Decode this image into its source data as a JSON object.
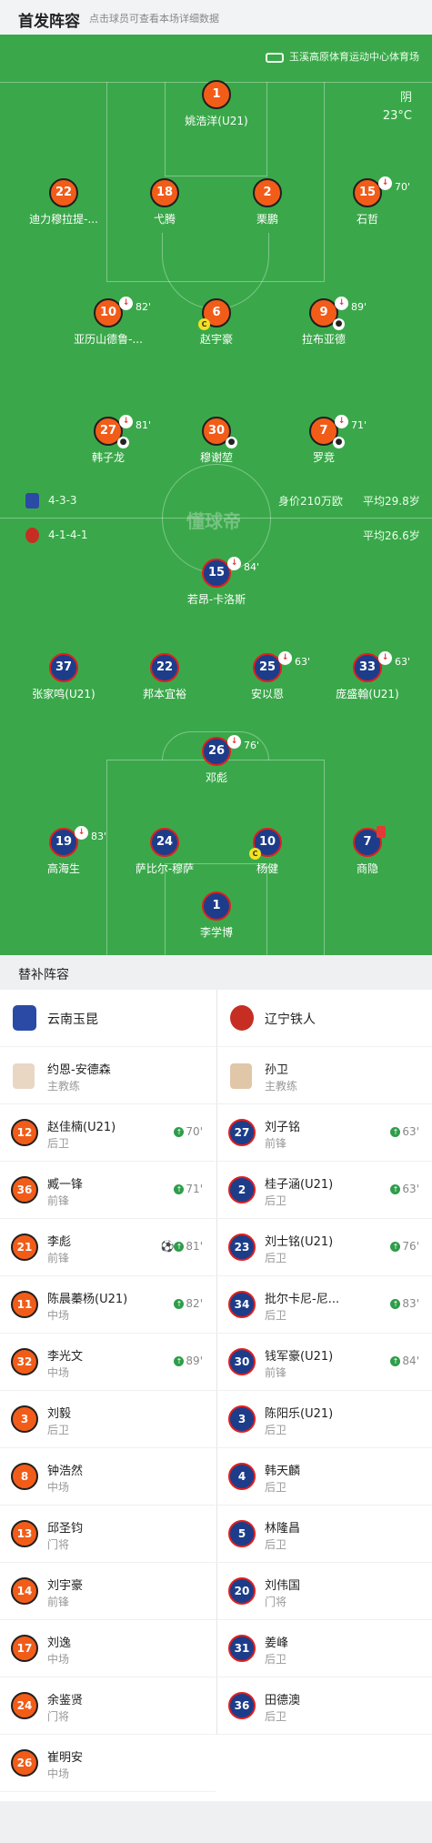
{
  "header": {
    "title": "首发阵容",
    "subtitle": "点击球员可查看本场详细数据"
  },
  "venue": "玉溪高原体育运动中心体育场",
  "weather": {
    "condition": "阴",
    "temp": "23°C"
  },
  "watermark": "懂球帝",
  "home_form": {
    "formation": "4-3-3",
    "value": "身价210万欧",
    "avg_age": "平均29.8岁"
  },
  "away_form": {
    "formation": "4-1-4-1",
    "avg_age": "平均26.6岁"
  },
  "pitch_home": [
    {
      "num": "1",
      "name": "姚浩洋(U21)"
    },
    {
      "num": "22",
      "name": "迪力穆拉提-..."
    },
    {
      "num": "18",
      "name": "弋腾"
    },
    {
      "num": "2",
      "name": "栗鹏"
    },
    {
      "num": "15",
      "name": "石哲",
      "sub": "70'"
    },
    {
      "num": "10",
      "name": "亚历山德鲁-...",
      "sub": "82'"
    },
    {
      "num": "6",
      "name": "赵宇豪"
    },
    {
      "num": "9",
      "name": "拉布亚德",
      "sub": "89'"
    },
    {
      "num": "27",
      "name": "韩子龙",
      "sub": "81'"
    },
    {
      "num": "30",
      "name": "穆谢堃"
    },
    {
      "num": "7",
      "name": "罗竞",
      "sub": "71'"
    }
  ],
  "pitch_away": [
    {
      "num": "15",
      "name": "若昂-卡洛斯",
      "sub": "84'"
    },
    {
      "num": "37",
      "name": "张家鸣(U21)"
    },
    {
      "num": "22",
      "name": "邦本宜裕"
    },
    {
      "num": "25",
      "name": "安以恩",
      "sub": "63'"
    },
    {
      "num": "33",
      "name": "庞盛翰(U21)",
      "sub": "63'"
    },
    {
      "num": "26",
      "name": "邓彪",
      "sub": "76'"
    },
    {
      "num": "19",
      "name": "高海生",
      "sub": "83'"
    },
    {
      "num": "24",
      "name": "萨比尔-穆萨"
    },
    {
      "num": "10",
      "name": "杨健"
    },
    {
      "num": "7",
      "name": "商隐"
    },
    {
      "num": "1",
      "name": "李学博"
    }
  ],
  "subs_title": "替补阵容",
  "home_team": {
    "name": "云南玉昆",
    "coach": "约恩-安德森",
    "coach_role": "主教练"
  },
  "away_team": {
    "name": "辽宁铁人",
    "coach": "孙卫",
    "coach_role": "主教练"
  },
  "home_subs": [
    {
      "num": "12",
      "name": "赵佳楠(U21)",
      "pos": "后卫",
      "time": "70'"
    },
    {
      "num": "36",
      "name": "臧一锋",
      "pos": "前锋",
      "time": "71'"
    },
    {
      "num": "21",
      "name": "李彪",
      "pos": "前锋",
      "time": "81'"
    },
    {
      "num": "11",
      "name": "陈晨蓁杨(U21)",
      "pos": "中场",
      "time": "82'"
    },
    {
      "num": "32",
      "name": "李光文",
      "pos": "中场",
      "time": "89'"
    },
    {
      "num": "3",
      "name": "刘毅",
      "pos": "后卫"
    },
    {
      "num": "8",
      "name": "钟浩然",
      "pos": "中场"
    },
    {
      "num": "13",
      "name": "邱圣钧",
      "pos": "门将"
    },
    {
      "num": "14",
      "name": "刘宇豪",
      "pos": "前锋"
    },
    {
      "num": "17",
      "name": "刘逸",
      "pos": "中场"
    },
    {
      "num": "24",
      "name": "余鉴贤",
      "pos": "门将"
    },
    {
      "num": "26",
      "name": "崔明安",
      "pos": "中场"
    }
  ],
  "away_subs": [
    {
      "num": "27",
      "name": "刘子铭",
      "pos": "前锋",
      "time": "63'"
    },
    {
      "num": "2",
      "name": "桂子涵(U21)",
      "pos": "后卫",
      "time": "63'"
    },
    {
      "num": "23",
      "name": "刘士铭(U21)",
      "pos": "后卫",
      "time": "76'"
    },
    {
      "num": "34",
      "name": "批尔卡尼-尼...",
      "pos": "后卫",
      "time": "83'"
    },
    {
      "num": "30",
      "name": "钱军豪(U21)",
      "pos": "前锋",
      "time": "84'"
    },
    {
      "num": "3",
      "name": "陈阳乐(U21)",
      "pos": "后卫"
    },
    {
      "num": "4",
      "name": "韩天麟",
      "pos": "后卫"
    },
    {
      "num": "5",
      "name": "林隆昌",
      "pos": "后卫"
    },
    {
      "num": "20",
      "name": "刘伟国",
      "pos": "门将"
    },
    {
      "num": "31",
      "name": "姜峰",
      "pos": "后卫"
    },
    {
      "num": "36",
      "name": "田德澳",
      "pos": "后卫"
    }
  ],
  "colors": {
    "pitch": "#3aa84a",
    "home": "#f25c19",
    "away": "#1d3d8a",
    "away_border": "#e01f1f"
  }
}
